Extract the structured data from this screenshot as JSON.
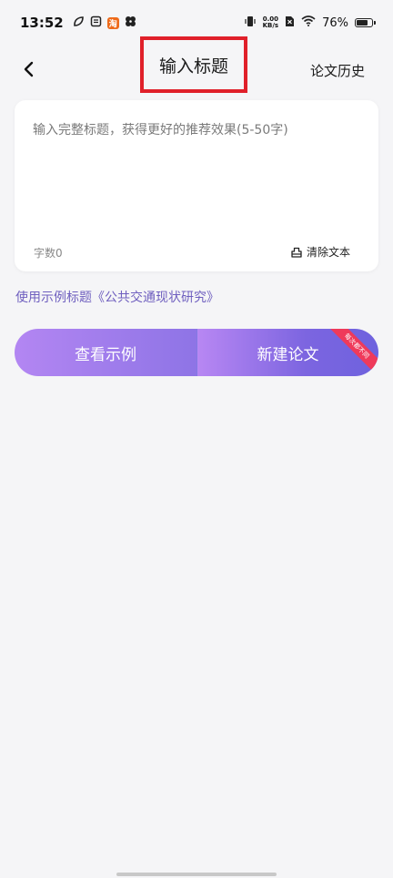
{
  "status_bar": {
    "time": "13:52",
    "net_speed_value": "0.00",
    "net_speed_unit": "KB/s",
    "battery_percent": "76%",
    "battery_level": 0.76
  },
  "nav": {
    "title": "输入标题",
    "history_label": "论文历史"
  },
  "input_card": {
    "placeholder": "输入完整标题，获得更好的推荐效果(5-50字)",
    "value": "",
    "char_count": "字数0",
    "clear_label": "清除文本"
  },
  "example_title_link": "使用示例标题《公共交通现状研究》",
  "actions": {
    "view_example_label": "查看示例",
    "new_paper_label": "新建论文",
    "ribbon_label": "每次都不同"
  },
  "colors": {
    "accent_purple": "#8e74e6",
    "link_purple": "#6f5fbf",
    "ribbon_red": "#ef3a5a",
    "highlight_red": "#e0202a",
    "page_bg": "#f5f5f7"
  }
}
